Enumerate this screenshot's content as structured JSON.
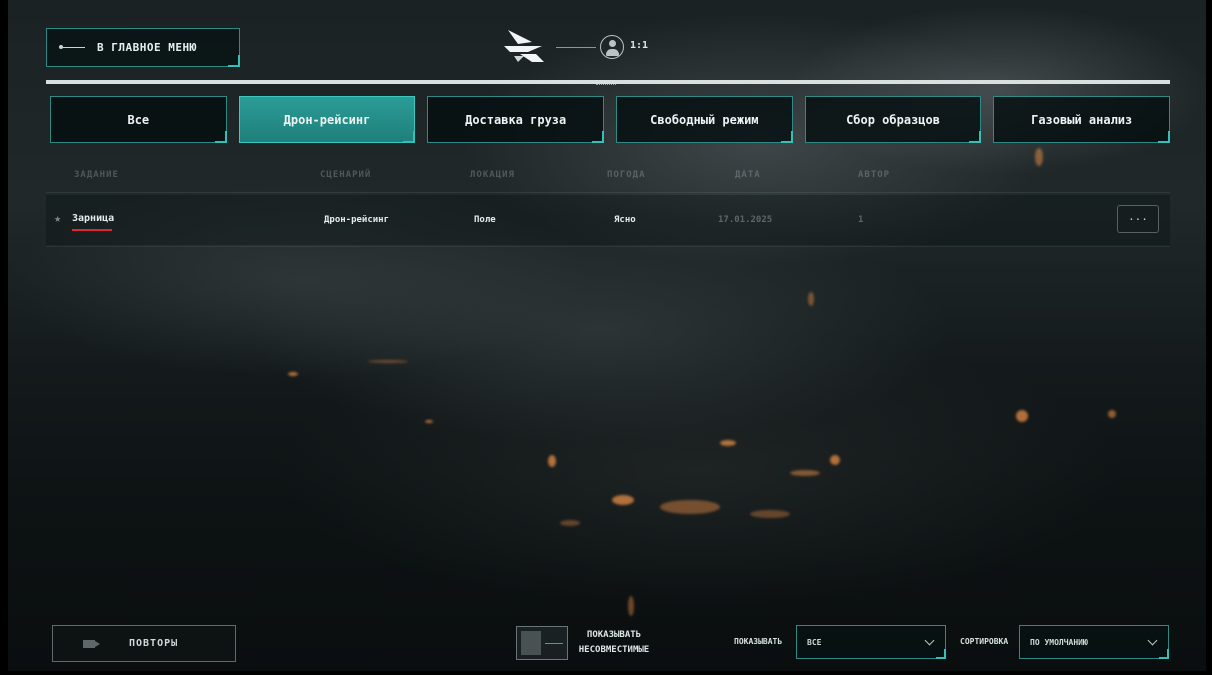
{
  "header": {
    "back_label": "В ГЛАВНОЕ МЕНЮ",
    "ratio": "1:1"
  },
  "tabs": [
    {
      "label": "Все",
      "active": false
    },
    {
      "label": "Дрон-рейсинг",
      "active": true
    },
    {
      "label": "Доставка груза",
      "active": false
    },
    {
      "label": "Свободный режим",
      "active": false
    },
    {
      "label": "Сбор образцов",
      "active": false
    },
    {
      "label": "Газовый анализ",
      "active": false
    }
  ],
  "table": {
    "columns": {
      "task": "ЗАДАНИЕ",
      "scenario": "СЦЕНАРИЙ",
      "location": "ЛОКАЦИЯ",
      "weather": "ПОГОДА",
      "date": "ДАТА",
      "author": "АВТОР"
    },
    "rows": [
      {
        "task": "Зарница",
        "scenario": "Дрон-рейсинг",
        "location": "Поле",
        "weather": "Ясно",
        "date": "17.01.2025",
        "author": "1",
        "more": "···"
      }
    ]
  },
  "footer": {
    "replays_label": "ПОВТОРЫ",
    "toggle_label_line1": "ПОКАЗЫВАТЬ",
    "toggle_label_line2": "НЕСОВМЕСТИМЫЕ",
    "show_label": "ПОКАЗЫВАТЬ",
    "show_value": "ВСЕ",
    "sort_label": "СОРТИРОВКА",
    "sort_value": "ПО УМОЛЧАНИЮ"
  },
  "colors": {
    "accent": "#2b9c97",
    "accent_border": "#35c0b7",
    "underline": "#e0262c"
  }
}
